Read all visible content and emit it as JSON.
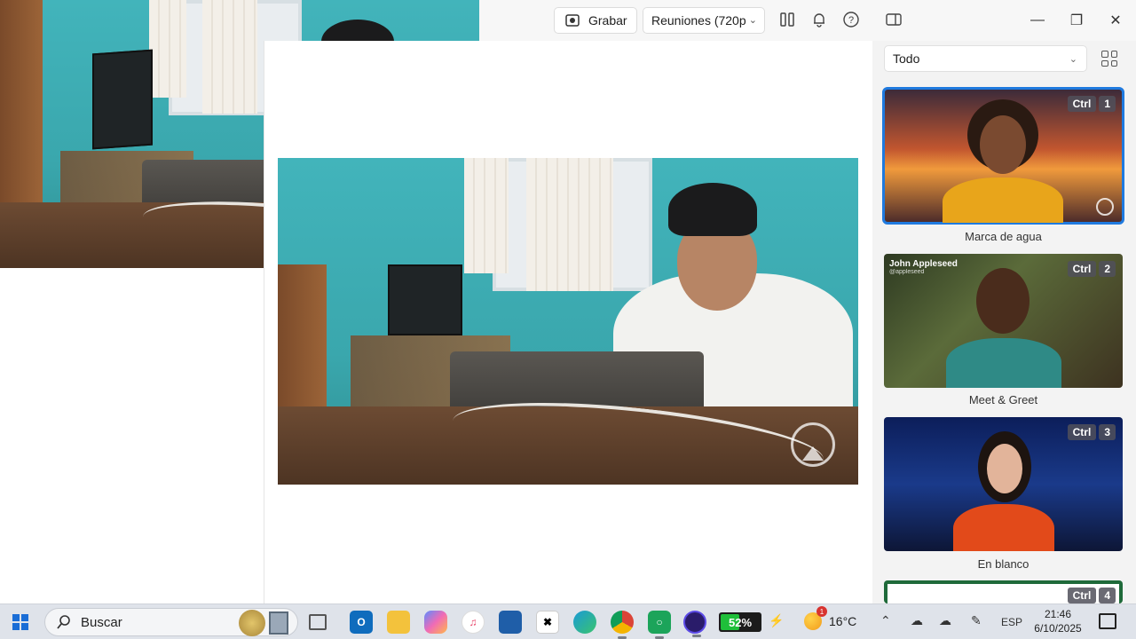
{
  "toolbar": {
    "record_label": "Grabar",
    "meeting_select_value": "Reuniones (720p",
    "icons": [
      "record-icon",
      "split-view-icon",
      "bell-icon",
      "help-icon",
      "panel-icon",
      "minimize-icon",
      "maximize-icon",
      "close-icon"
    ]
  },
  "right_panel": {
    "filter_value": "Todo",
    "cards": [
      {
        "label": "Marca de agua",
        "shortcut_mod": "Ctrl",
        "shortcut_key": "1",
        "selected": true
      },
      {
        "label": "Meet & Greet",
        "shortcut_mod": "Ctrl",
        "shortcut_key": "2",
        "selected": false,
        "overlay_name": "John Appleseed",
        "overlay_handle": "@appleseed"
      },
      {
        "label": "En blanco",
        "shortcut_mod": "Ctrl",
        "shortcut_key": "3",
        "selected": false
      },
      {
        "label": "",
        "shortcut_mod": "Ctrl",
        "shortcut_key": "4",
        "selected": false
      }
    ]
  },
  "taskbar": {
    "search_placeholder": "Buscar",
    "battery_percent": "52%",
    "battery_level": 0.52,
    "temperature": "16°C",
    "weather_badge": "1",
    "language": "ESP",
    "time": "21:46",
    "date": "6/10/2025",
    "colors": {
      "accent": "#1f7adf",
      "battery": "#1fbf3a"
    }
  }
}
